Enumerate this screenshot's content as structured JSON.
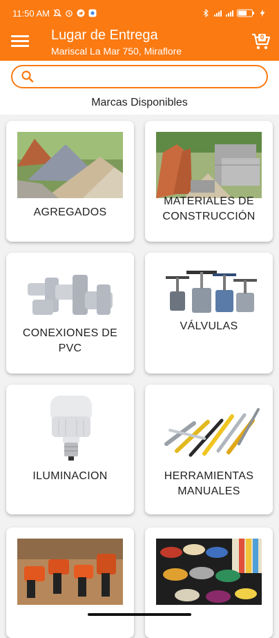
{
  "status_bar": {
    "time": "11:50 AM",
    "network": "4G",
    "battery": "55"
  },
  "header": {
    "title": "Lugar de Entrega",
    "address": "Mariscal La Mar 750, Miraflore",
    "cart_count": "0"
  },
  "search": {
    "placeholder": "",
    "value": ""
  },
  "section": {
    "title": "Marcas Disponibles"
  },
  "categories": [
    {
      "label": "AGREGADOS",
      "icon": "gravel-piles-image"
    },
    {
      "label": "MATERIALES DE CONSTRUCCIÓN",
      "icon": "bricks-blocks-image"
    },
    {
      "label": "CONEXIONES DE PVC",
      "icon": "pvc-fittings-image"
    },
    {
      "label": "VÁLVULAS",
      "icon": "valves-image"
    },
    {
      "label": "ILUMINACION",
      "icon": "led-bulb-image"
    },
    {
      "label": "HERRAMIENTAS MANUALES",
      "icon": "hand-tools-image"
    },
    {
      "label": "",
      "icon": "power-tools-image"
    },
    {
      "label": "",
      "icon": "paint-cans-image"
    }
  ],
  "colors": {
    "accent": "#fb7a12",
    "background": "#f2f2f2"
  }
}
